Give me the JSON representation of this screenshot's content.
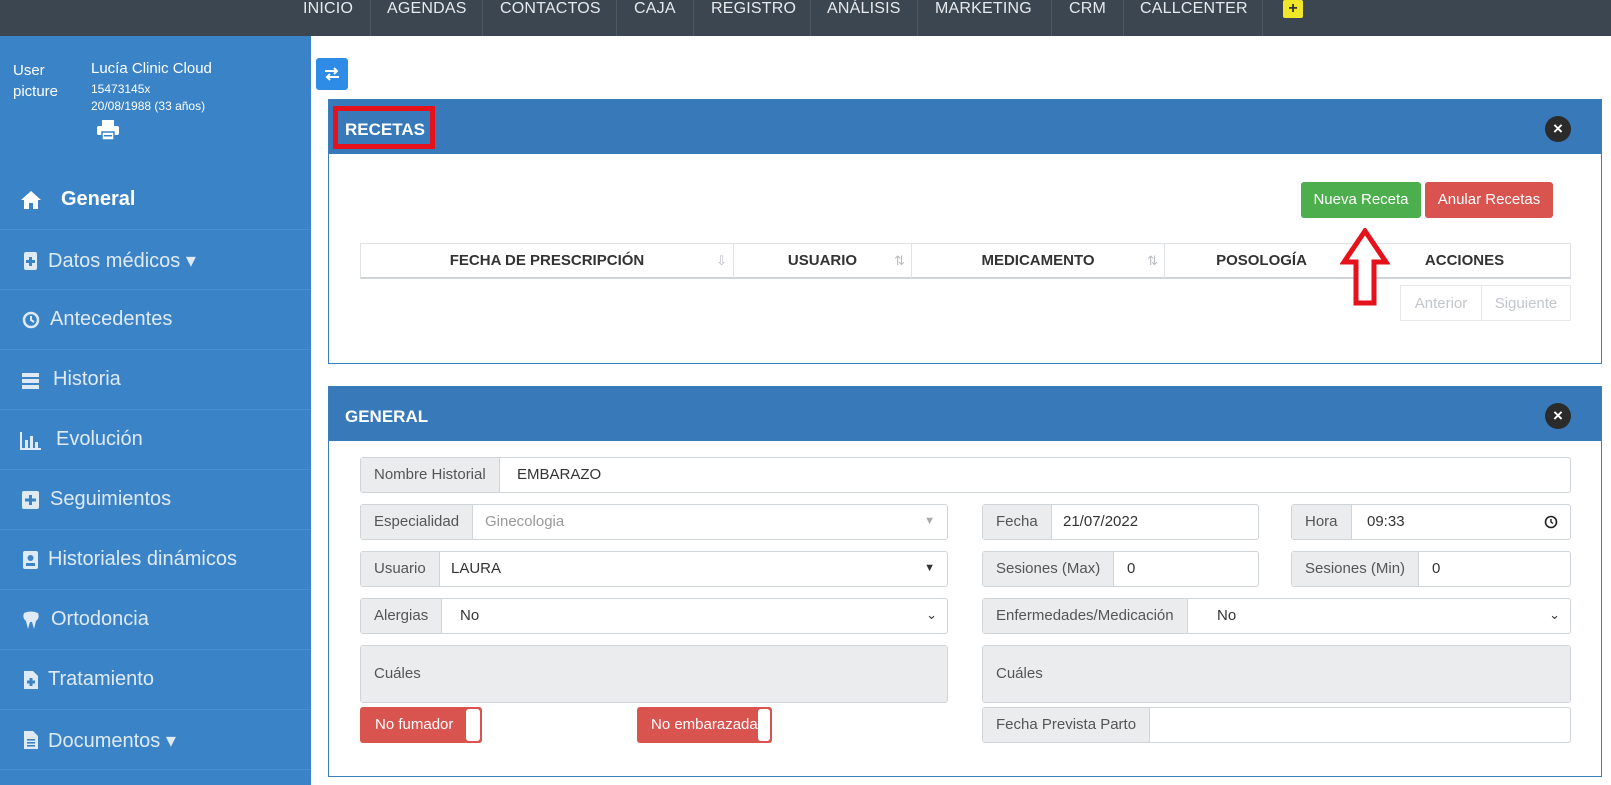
{
  "topnav": {
    "items": [
      "INICIO",
      "AGENDAS",
      "CONTACTOS",
      "CAJA",
      "REGISTRO",
      "ANÁLISIS",
      "MARKETING",
      "CRM",
      "CALLCENTER"
    ],
    "plus": "+"
  },
  "user": {
    "picture_alt": "User picture",
    "name": "Lucía Clinic Cloud",
    "id": "15473145x",
    "dob": "20/08/1988 (33 años)"
  },
  "sidebar": {
    "items": [
      {
        "label": "General",
        "icon": "home-icon"
      },
      {
        "label": "Datos médicos ▾",
        "icon": "medical-clipboard-icon"
      },
      {
        "label": "Antecedentes",
        "icon": "history-icon"
      },
      {
        "label": "Historia",
        "icon": "list-icon"
      },
      {
        "label": "Evolución",
        "icon": "bar-chart-icon"
      },
      {
        "label": "Seguimientos",
        "icon": "plus-square-icon"
      },
      {
        "label": "Historiales dinámicos",
        "icon": "id-badge-icon"
      },
      {
        "label": "Ortodoncia",
        "icon": "tooth-icon"
      },
      {
        "label": "Tratamiento",
        "icon": "file-plus-icon"
      },
      {
        "label": "Documentos ▾",
        "icon": "document-icon"
      }
    ]
  },
  "recetas": {
    "title": "RECETAS",
    "new_button": "Nueva Receta",
    "cancel_button": "Anular Recetas",
    "columns": [
      "FECHA DE PRESCRIPCIÓN",
      "USUARIO",
      "MEDICAMENTO",
      "POSOLOGÍA",
      "ACCIONES"
    ],
    "prev": "Anterior",
    "next": "Siguiente"
  },
  "general": {
    "title": "GENERAL",
    "nombre_label": "Nombre Historial",
    "nombre_value": "EMBARAZO",
    "especialidad_label": "Especialidad",
    "especialidad_value": "Ginecologia",
    "fecha_label": "Fecha",
    "fecha_value": "21/07/2022",
    "hora_label": "Hora",
    "hora_value": "09:33",
    "usuario_label": "Usuario",
    "usuario_value": "LAURA",
    "sesiones_max_label": "Sesiones (Max)",
    "sesiones_max_value": "0",
    "sesiones_min_label": "Sesiones (Min)",
    "sesiones_min_value": "0",
    "alergias_label": "Alergias",
    "alergias_value": "No",
    "enfermedades_label": "Enfermedades/Medicación",
    "enfermedades_value": "No",
    "cuales_label_1": "Cuáles",
    "cuales_label_2": "Cuáles",
    "fumador_toggle": "No fumador",
    "embarazada_toggle": "No embarazada",
    "fecha_parto_label": "Fecha Prevista Parto",
    "fecha_parto_value": ""
  },
  "colors": {
    "sidebar": "#3a83c7",
    "topnav": "#3c4650",
    "panel_header": "#3779b9",
    "green": "#4cae4c",
    "red": "#d9534f",
    "highlight": "#e5121b"
  }
}
